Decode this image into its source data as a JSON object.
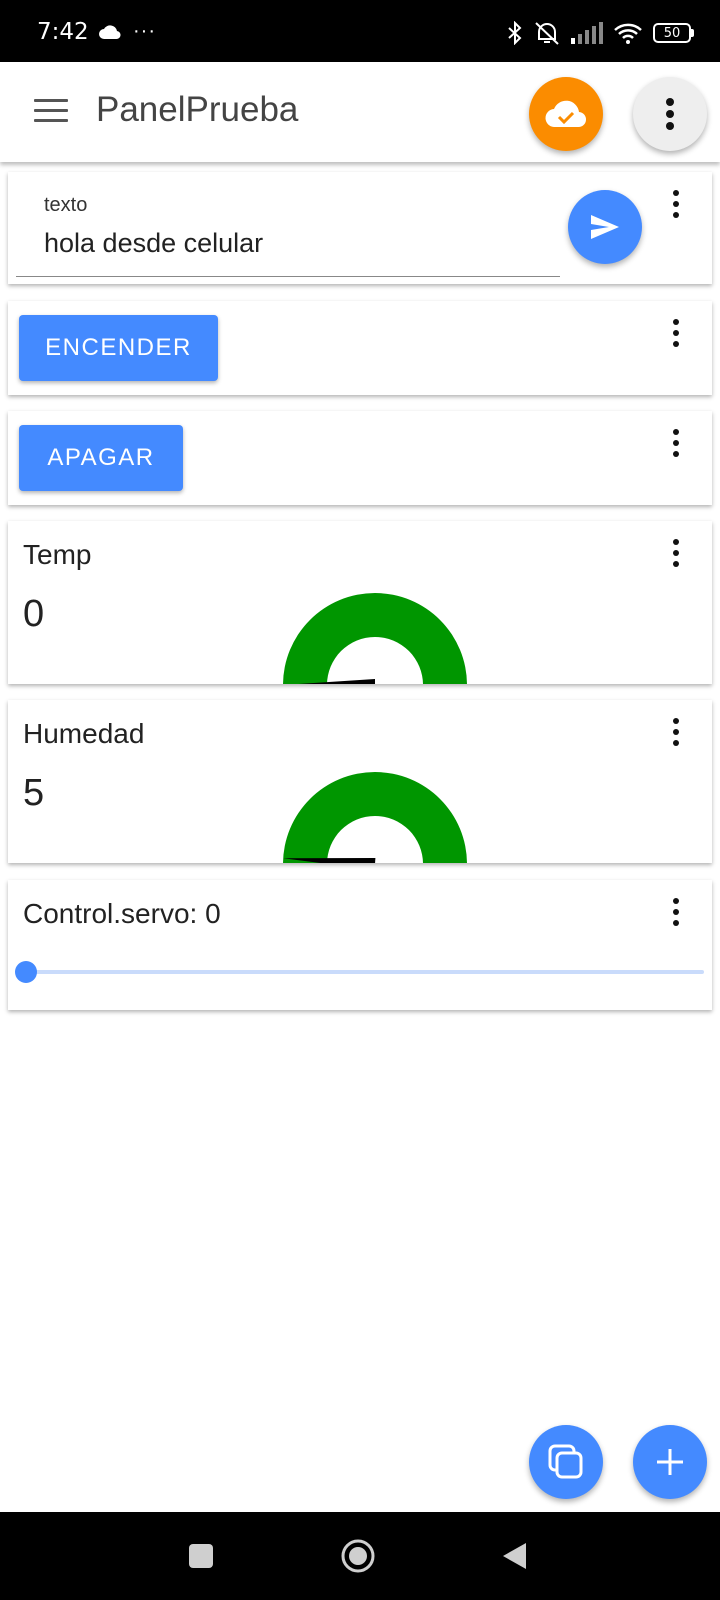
{
  "status_bar": {
    "time": "7:42",
    "overflow_dots": "···",
    "battery": "50",
    "icons": [
      "cloud-icon",
      "bluetooth-icon",
      "alarm-off-icon",
      "signal-icon",
      "wifi-icon",
      "battery-icon"
    ]
  },
  "app_bar": {
    "title": "PanelPrueba",
    "icons": [
      "menu-icon",
      "cloud-check-icon",
      "more-vert-icon"
    ],
    "cloud_color": "#fb8c00"
  },
  "text_widget": {
    "label": "texto",
    "value": "hola desde celular",
    "send_icon": "send-icon"
  },
  "button_widgets": [
    {
      "label": "ENCENDER"
    },
    {
      "label": "APAGAR"
    }
  ],
  "gauges": [
    {
      "label": "Temp",
      "value": "0",
      "level": 0
    },
    {
      "label": "Humedad",
      "value": "5",
      "level": 0.02
    }
  ],
  "slider_widget": {
    "label": "Control.servo: 0",
    "value": 0
  },
  "fabs": [
    "copy-icon",
    "add-icon"
  ],
  "nav_bar": [
    "recents-icon",
    "home-icon",
    "back-icon"
  ],
  "colors": {
    "accent": "#448aff",
    "gauge_fill": "#009600",
    "cloud_button": "#fb8c00",
    "slider_track": "#c9dbfb"
  }
}
